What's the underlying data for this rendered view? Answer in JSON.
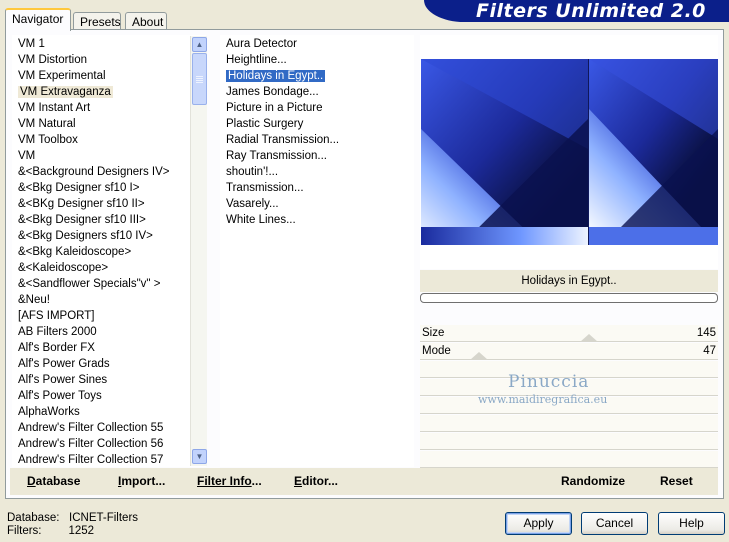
{
  "app": {
    "title": "Filters Unlimited 2.0"
  },
  "tabs": [
    {
      "label": "Navigator",
      "active": true
    },
    {
      "label": "Presets",
      "active": false
    },
    {
      "label": "About",
      "active": false
    }
  ],
  "categories": {
    "selected": "VM Extravaganza",
    "items": [
      "VM 1",
      "VM Distortion",
      "VM Experimental",
      "VM Extravaganza",
      "VM Instant Art",
      "VM Natural",
      "VM Toolbox",
      "VM",
      "&<Background Designers IV>",
      "&<Bkg Designer sf10 I>",
      "&<BKg Designer sf10 II>",
      "&<Bkg Designer sf10 III>",
      "&<Bkg Designers sf10 IV>",
      "&<Bkg Kaleidoscope>",
      "&<Kaleidoscope>",
      "&<Sandflower Specials\"v\" >",
      "&Neu!",
      "[AFS IMPORT]",
      "AB Filters 2000",
      "Alf's Border FX",
      "Alf's Power Grads",
      "Alf's Power Sines",
      "Alf's Power Toys",
      "AlphaWorks",
      "Andrew's Filter Collection 55",
      "Andrew's Filter Collection 56",
      "Andrew's Filter Collection 57"
    ]
  },
  "filters": {
    "selected": "Holidays in Egypt..",
    "items": [
      " Aura Detector",
      "Heightline...",
      "Holidays in Egypt..",
      "James Bondage...",
      "Picture in a Picture",
      "Plastic Surgery",
      "Radial Transmission...",
      "Ray Transmission...",
      "shoutin'!...",
      "Transmission...",
      "Vasarely...",
      "White Lines..."
    ]
  },
  "preview": {
    "filter_name": "Holidays in Egypt..",
    "colors": {
      "dark": "#0a0f3c",
      "mid": "#2b43c8",
      "light": "#e8f2ff"
    }
  },
  "parameters": [
    {
      "label": "Size",
      "value": "145",
      "fraction": 0.57
    },
    {
      "label": "Mode",
      "value": "47",
      "fraction": 0.18
    }
  ],
  "watermark": {
    "line1": "Pinuccia",
    "line2": "www.maidiregrafica.eu"
  },
  "bottom_links": [
    {
      "label": "Database",
      "underline": "D",
      "rest": "atabase"
    },
    {
      "label": "Import...",
      "underline": "I",
      "rest": "mport..."
    },
    {
      "label": "Filter Info...",
      "underline": "Filter Info",
      "rest": "..."
    },
    {
      "label": "Editor...",
      "underline": "E",
      "rest": "ditor..."
    }
  ],
  "actions": {
    "randomize": "Randomize",
    "reset": "Reset"
  },
  "status": {
    "database_label": "Database:",
    "database_value": "ICNET-Filters",
    "filters_label": "Filters:",
    "filters_value": "1252"
  },
  "dialog_buttons": {
    "apply": "Apply",
    "cancel": "Cancel",
    "help": "Help"
  }
}
